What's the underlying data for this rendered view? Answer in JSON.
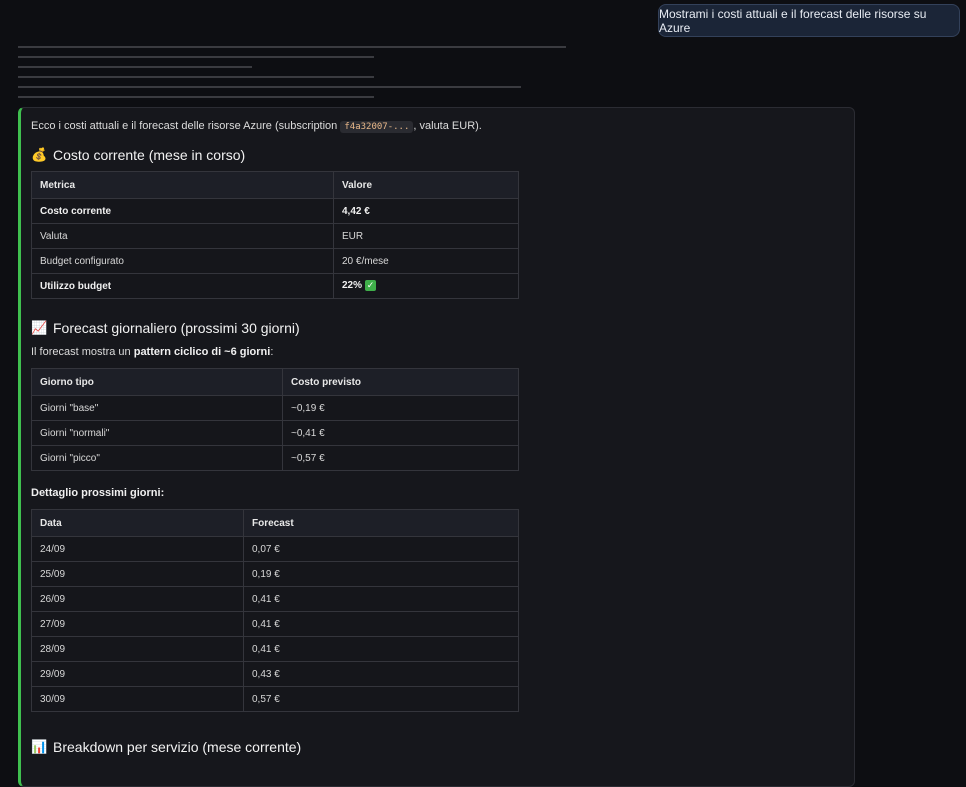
{
  "user_message": "Mostrami i costi attuali e il forecast delle risorse su Azure",
  "intro": {
    "before": "Ecco i costi attuali e il forecast delle risorse Azure (subscription ",
    "code": "f4a32007-...",
    "after": ", valuta EUR)."
  },
  "section_current": {
    "emoji": "💰",
    "title": "Costo corrente (mese in corso)",
    "headers": [
      "Metrica",
      "Valore"
    ],
    "rows": [
      {
        "metric": "Costo corrente",
        "value": "4,42 €",
        "bold": true
      },
      {
        "metric": "Valuta",
        "value": "EUR",
        "bold": false
      },
      {
        "metric": "Budget configurato",
        "value": "20 €/mese",
        "bold": false
      },
      {
        "metric": "Utilizzo budget",
        "value": "22%",
        "bold": true,
        "icon": "check-icon"
      }
    ]
  },
  "section_forecast": {
    "emoji": "📈",
    "title": "Forecast giornaliero (prossimi 30 giorni)",
    "para_before": "Il forecast mostra un ",
    "para_bold": "pattern ciclico di ~6 giorni",
    "para_after": ":",
    "headers": [
      "Giorno tipo",
      "Costo previsto"
    ],
    "rows": [
      {
        "type": "Giorni \"base\"",
        "cost": "~0,19 €"
      },
      {
        "type": "Giorni \"normali\"",
        "cost": "~0,41 €"
      },
      {
        "type": "Giorni \"picco\"",
        "cost": "~0,57 €"
      }
    ]
  },
  "section_detail": {
    "title": "Dettaglio prossimi giorni:",
    "headers": [
      "Data",
      "Forecast"
    ],
    "rows": [
      {
        "date": "24/09",
        "value": "0,07 €"
      },
      {
        "date": "25/09",
        "value": "0,19 €"
      },
      {
        "date": "26/09",
        "value": "0,41 €"
      },
      {
        "date": "27/09",
        "value": "0,41 €"
      },
      {
        "date": "28/09",
        "value": "0,41 €"
      },
      {
        "date": "29/09",
        "value": "0,43 €"
      },
      {
        "date": "30/09",
        "value": "0,57 €"
      }
    ]
  },
  "section_breakdown": {
    "emoji": "📊",
    "title": "Breakdown per servizio (mese corrente)"
  }
}
